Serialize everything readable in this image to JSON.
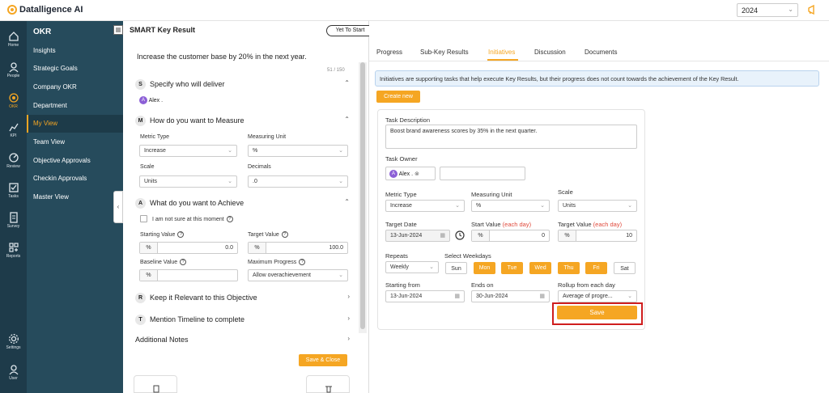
{
  "app": {
    "name": "Datalligence AI",
    "year": "2024"
  },
  "rail": [
    {
      "label": "Home",
      "icon": "home-icon"
    },
    {
      "label": "People",
      "icon": "people-icon"
    },
    {
      "label": "OKR",
      "icon": "target-icon"
    },
    {
      "label": "KPI",
      "icon": "chart-icon"
    },
    {
      "label": "Review",
      "icon": "gauge-icon"
    },
    {
      "label": "Tasks",
      "icon": "tasks-icon"
    },
    {
      "label": "Survey",
      "icon": "survey-icon"
    },
    {
      "label": "Reports",
      "icon": "reports-icon"
    },
    {
      "label": "Settings",
      "icon": "settings-icon"
    },
    {
      "label": "User",
      "icon": "user-icon"
    }
  ],
  "sidebar": {
    "title": "OKR",
    "items": [
      "Insights",
      "Strategic Goals",
      "Company OKR",
      "Department",
      "My View",
      "Team View",
      "Objective Approvals",
      "Checkin Approvals",
      "Master View"
    ]
  },
  "left": {
    "title": "SMART Key Result",
    "status": "Yet To Start",
    "objective": "Increase the customer base by 20% in the next year.",
    "counter": "51 / 150",
    "sec_s": {
      "letter": "S",
      "title": "Specify who will deliver",
      "owner": "Alex ."
    },
    "sec_m": {
      "letter": "M",
      "title": "How do you want to Measure",
      "metric_type_label": "Metric Type",
      "metric_type": "Increase",
      "unit_label": "Measuring Unit",
      "unit": "%",
      "scale_label": "Scale",
      "scale": "Units",
      "decimals_label": "Decimals",
      "decimals": ".0"
    },
    "sec_a": {
      "letter": "A",
      "title": "What do you want to Achieve",
      "not_sure": "I am not sure at this moment",
      "start_label": "Starting Value",
      "start_pre": "%",
      "start_val": "0.0",
      "target_label": "Target Value",
      "target_pre": "%",
      "target_val": "100.0",
      "baseline_label": "Baseline Value",
      "baseline_pre": "%",
      "maxprog_label": "Maximum Progress",
      "maxprog": "Allow overachievement"
    },
    "sec_r": {
      "letter": "R",
      "title": "Keep it Relevant to this Objective"
    },
    "sec_t": {
      "letter": "T",
      "title": "Mention Timeline to complete"
    },
    "notes": "Additional Notes",
    "save_close": "Save & Close"
  },
  "right": {
    "tabs": [
      "Progress",
      "Sub-Key Results",
      "Initiatives",
      "Discussion",
      "Documents"
    ],
    "active_tab": "Initiatives",
    "info": "Initiatives are supporting tasks that help execute Key Results, but their progress does not count towards the achievement of the Key Result.",
    "create_new": "Create new",
    "task_desc_label": "Task Description",
    "task_desc": "Boost brand awareness scores by 35% in the next quarter.",
    "owner_label": "Task Owner",
    "owner": "Alex .",
    "metric_type_label": "Metric Type",
    "metric_type": "Increase",
    "unit_label": "Measuring Unit",
    "unit": "%",
    "scale_label": "Scale",
    "scale": "Units",
    "target_date_label": "Target Date",
    "target_date": "13-Jun-2024",
    "start_value_label": "Start Value",
    "each_day": "(each day)",
    "start_pre": "%",
    "start_val": "0",
    "target_value_label": "Target Value",
    "target_pre": "%",
    "target_val": "10",
    "repeats_label": "Repeats",
    "repeats": "Weekly",
    "weekdays_label": "Select Weekdays",
    "days": [
      {
        "label": "Sun",
        "on": false
      },
      {
        "label": "Mon",
        "on": true
      },
      {
        "label": "Tue",
        "on": true
      },
      {
        "label": "Wed",
        "on": true
      },
      {
        "label": "Thu",
        "on": true
      },
      {
        "label": "Fri",
        "on": true
      },
      {
        "label": "Sat",
        "on": false
      }
    ],
    "starting_label": "Starting from",
    "starting": "13-Jun-2024",
    "ends_label": "Ends on",
    "ends": "30-Jun-2024",
    "rollup_label": "Rollup from each day",
    "rollup": "Average of progre...",
    "save": "Save"
  },
  "colors": {
    "accent": "#f5a623",
    "rail": "#1e3b4a",
    "sidebar": "#264b5c",
    "highlight": "#cf1e1e"
  }
}
